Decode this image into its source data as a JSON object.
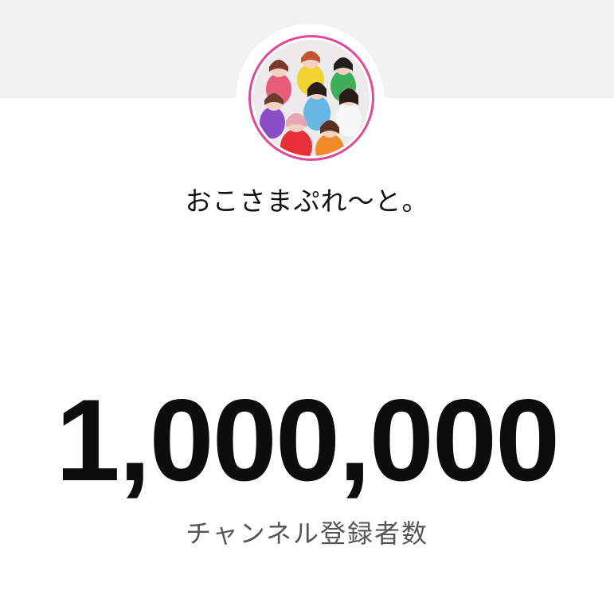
{
  "channel": {
    "name": "おこさまぷれ〜と。",
    "avatar_icon": "group-photo-avatar-icon",
    "ring_color": "#e0489a"
  },
  "stats": {
    "subscriber_count": "1,000,000",
    "subscriber_label": "チャンネル登録者数"
  },
  "colors": {
    "top_band": "#f2f2f2",
    "background": "#ffffff",
    "count_text": "#0d0d0d",
    "label_text": "#555555"
  }
}
